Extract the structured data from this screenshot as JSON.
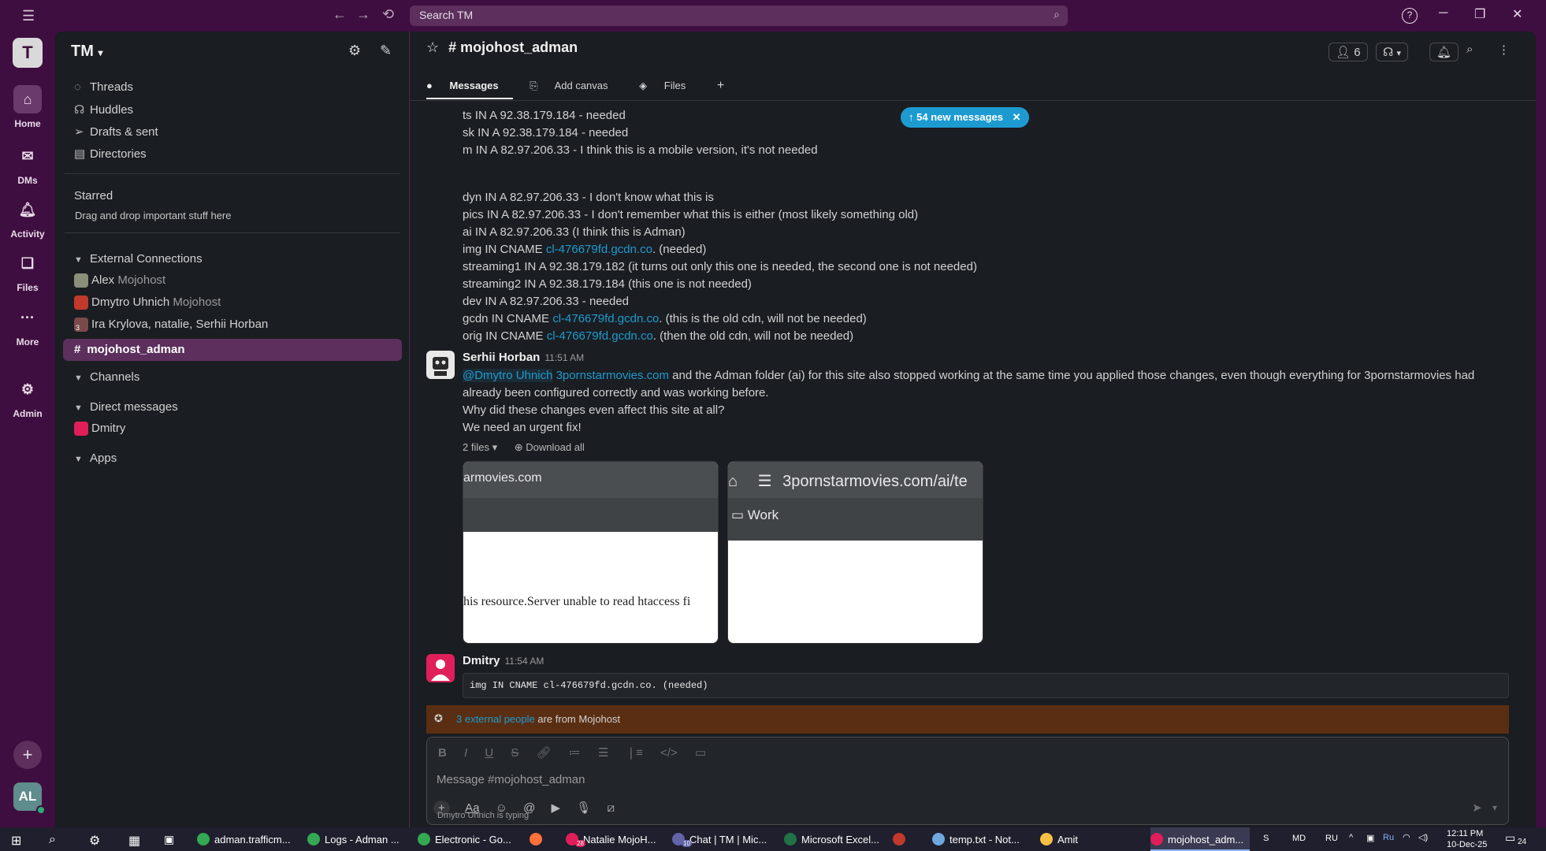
{
  "titlebar": {
    "search_placeholder": "Search TM"
  },
  "rail": {
    "workspace_initial": "T",
    "items": [
      {
        "label": "Home",
        "icon": "home-icon"
      },
      {
        "label": "DMs",
        "icon": "dms-icon"
      },
      {
        "label": "Activity",
        "icon": "bell-icon"
      },
      {
        "label": "Files",
        "icon": "files-icon"
      },
      {
        "label": "More",
        "icon": "more-icon"
      },
      {
        "label": "Admin",
        "icon": "gear-icon"
      }
    ],
    "user_initials": "AL"
  },
  "sidebar": {
    "workspace_name": "TM",
    "links": [
      "Threads",
      "Huddles",
      "Drafts & sent",
      "Directories"
    ],
    "starred": {
      "title": "Starred",
      "hint": "Drag and drop important stuff here"
    },
    "external": {
      "title": "External Connections",
      "items": [
        {
          "name": "Alex",
          "org": "Mojohost"
        },
        {
          "name": "Dmytro Uhnich",
          "org": "Mojohost"
        },
        {
          "name": "Ira Krylova, natalie, Serhii Horban",
          "org": ""
        }
      ],
      "group_count": "3",
      "active_channel": "mojohost_adman"
    },
    "channels_title": "Channels",
    "dm_title": "Direct messages",
    "dms": [
      "Dmitry"
    ],
    "apps_title": "Apps"
  },
  "channel": {
    "name": "# mojohost_adman",
    "tabs": [
      "Messages",
      "Add canvas",
      "Files"
    ],
    "member_count": "6",
    "new_messages": "54 new messages"
  },
  "messages": {
    "top_lines": [
      "ts IN A 92.38.179.184 - needed",
      "sk IN A 92.38.179.184 - needed",
      "m IN A 82.97.206.33 - I think this is a mobile version, it's not needed"
    ],
    "lines2": [
      {
        "pre": "dyn IN A 82.97.206.33 - I don't know what this is",
        "link": "",
        "post": ""
      },
      {
        "pre": "pics IN A 82.97.206.33 - I don't remember what this is either (most likely something old)",
        "link": "",
        "post": ""
      },
      {
        "pre": "ai IN A 82.97.206.33 (I think this is Adman)",
        "link": "",
        "post": ""
      },
      {
        "pre": "img IN CNAME ",
        "link": "cl-476679fd.gcdn.co",
        "post": ". (needed)"
      },
      {
        "pre": "streaming1 IN A 92.38.179.182 (it turns out only this one is needed, the second one is not needed)",
        "link": "",
        "post": ""
      },
      {
        "pre": "streaming2 IN A 92.38.179.184 (this one is not needed)",
        "link": "",
        "post": ""
      },
      {
        "pre": "dev IN A 82.97.206.33 - needed",
        "link": "",
        "post": ""
      },
      {
        "pre": "gcdn IN CNAME ",
        "link": "cl-476679fd.gcdn.co",
        "post": ". (this is the old cdn, will not be needed)"
      },
      {
        "pre": "orig IN CNAME ",
        "link": "cl-476679fd.gcdn.co",
        "post": ". (then the old cdn, will not be needed)"
      }
    ],
    "serhii": {
      "author": "Serhii Horban",
      "time": "11:51 AM",
      "mention": "@Dmytro Uhnich",
      "link": "3pornstarmovies.com",
      "text1": " and the Adman folder (ai) for this site also stopped working at the same time you applied those changes, even though everything for 3pornstarmovies had",
      "text2": "already been configured correctly and was working before.",
      "text3": "Why did these changes even affect this site at all?",
      "text4": "We need an urgent fix!",
      "files_label": "2 files",
      "download_all": "Download all",
      "thumb1_url": "armovies.com",
      "thumb1_body": "his resource.Server unable to read htaccess fi",
      "thumb2_url": "3pornstarmovies.com/ai/te",
      "thumb2_folder": "Work"
    },
    "dmitry": {
      "author": "Dmitry",
      "time": "11:54 AM",
      "code": "img IN CNAME cl-476679fd.gcdn.co. (needed)"
    }
  },
  "banner": {
    "link": "3 external people",
    "text": " are from Mojohost"
  },
  "composer": {
    "placeholder": "Message #mojohost_adman",
    "typing": "Dmytro Uhnich is typing"
  },
  "taskbar": {
    "items": [
      {
        "label": "adman.trafficm...",
        "color": "#34a853"
      },
      {
        "label": "Logs - Adman ...",
        "color": "#34a853"
      },
      {
        "label": "Electronic - Go...",
        "color": "#34a853"
      },
      {
        "label": "",
        "color": "#ff7139"
      },
      {
        "label": "Natalie MojoH...",
        "color": "#e01e5a"
      },
      {
        "label": "Chat | TM | Mic...",
        "color": "#6264a7"
      },
      {
        "label": "Microsoft Excel...",
        "color": "#217346"
      },
      {
        "label": "",
        "color": "#c0392b"
      },
      {
        "label": "temp.txt - Not...",
        "color": "#6fa8dc"
      },
      {
        "label": "Amit",
        "color": "#f6c142"
      },
      {
        "label": "mojohost_adm...",
        "color": "#e01e5a"
      }
    ],
    "badges": {
      "natalie": "28",
      "chat": "10"
    },
    "tray": {
      "s": "S",
      "md": "MD",
      "ru": "RU",
      "ru2": "Ru",
      "time": "12:11 PM",
      "date": "10-Dec-25",
      "notif": "24"
    }
  },
  "colors": {
    "aubergine": "#3f0e40",
    "main_bg": "#1a1d21",
    "link": "#1d9bd1",
    "banner": "#5a2e12"
  }
}
